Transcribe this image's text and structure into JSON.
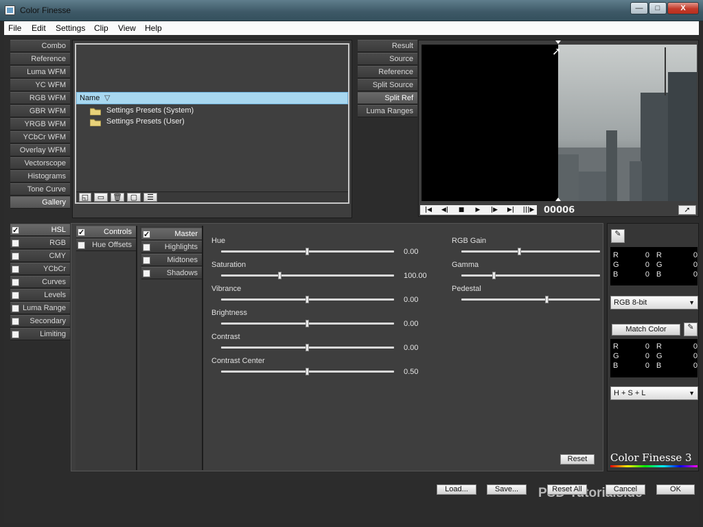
{
  "window": {
    "title": "Color Finesse",
    "min": "—",
    "max": "□",
    "close": "X"
  },
  "menu": [
    "File",
    "Edit",
    "Settings",
    "Clip",
    "View",
    "Help"
  ],
  "scopes": [
    "Combo",
    "Reference",
    "Luma WFM",
    "YC WFM",
    "RGB WFM",
    "GBR WFM",
    "YRGB WFM",
    "YCbCr WFM",
    "Overlay WFM",
    "Vectorscope",
    "Histograms",
    "Tone Curve",
    "Gallery"
  ],
  "scopes_selected": "Gallery",
  "gallery": {
    "name_header": "Name",
    "sort_icon": "▽",
    "items": [
      "Settings Presets (System)",
      "Settings Presets (User)"
    ]
  },
  "viewer_tabs": [
    "Result",
    "Source",
    "Reference",
    "Split Source",
    "Split Ref",
    "Luma Ranges"
  ],
  "viewer_selected": "Split Ref",
  "transport": {
    "frame": "00006"
  },
  "correction_tabs": [
    {
      "label": "HSL",
      "checked": true
    },
    {
      "label": "RGB",
      "checked": false
    },
    {
      "label": "CMY",
      "checked": false
    },
    {
      "label": "YCbCr",
      "checked": false
    },
    {
      "label": "Curves",
      "checked": false
    },
    {
      "label": "Levels",
      "checked": false
    },
    {
      "label": "Luma Range",
      "checked": false
    },
    {
      "label": "Secondary",
      "checked": false
    },
    {
      "label": "Limiting",
      "checked": false
    }
  ],
  "hsl_subtabs": [
    {
      "label": "Controls",
      "checked": true
    },
    {
      "label": "Hue Offsets",
      "checked": false
    }
  ],
  "range_tabs": [
    {
      "label": "Master",
      "checked": true
    },
    {
      "label": "Highlights",
      "checked": false
    },
    {
      "label": "Midtones",
      "checked": false
    },
    {
      "label": "Shadows",
      "checked": false
    }
  ],
  "sliders_left": [
    {
      "label": "Hue",
      "value": "0.00",
      "pos": 0.5
    },
    {
      "label": "Saturation",
      "value": "100.00",
      "pos": 0.34
    },
    {
      "label": "Vibrance",
      "value": "0.00",
      "pos": 0.5
    },
    {
      "label": "Brightness",
      "value": "0.00",
      "pos": 0.5
    },
    {
      "label": "Contrast",
      "value": "0.00",
      "pos": 0.5
    },
    {
      "label": "Contrast Center",
      "value": "0.50",
      "pos": 0.5
    }
  ],
  "sliders_right": [
    {
      "label": "RGB Gain",
      "pos": 0.42
    },
    {
      "label": "Gamma",
      "pos": 0.24
    },
    {
      "label": "Pedestal",
      "pos": 0.62
    }
  ],
  "reset_label": "Reset",
  "info": {
    "rgb_top": [
      [
        "R",
        "0",
        "R",
        "0"
      ],
      [
        "G",
        "0",
        "G",
        "0"
      ],
      [
        "B",
        "0",
        "B",
        "0"
      ]
    ],
    "format": "RGB 8-bit",
    "match_color": "Match Color",
    "rgb_bottom": [
      [
        "R",
        "0",
        "R",
        "0"
      ],
      [
        "G",
        "0",
        "G",
        "0"
      ],
      [
        "B",
        "0",
        "B",
        "0"
      ]
    ],
    "mode": "H + S + L",
    "logo": "Color Finesse 3"
  },
  "footer_buttons": [
    "Load...",
    "Save...",
    "Reset All",
    "Cancel",
    "OK"
  ],
  "watermark": "PSD-Tutorials.de",
  "colors": {
    "accent_selection": "#a8d8f0",
    "panel": "#3e3e3e"
  }
}
